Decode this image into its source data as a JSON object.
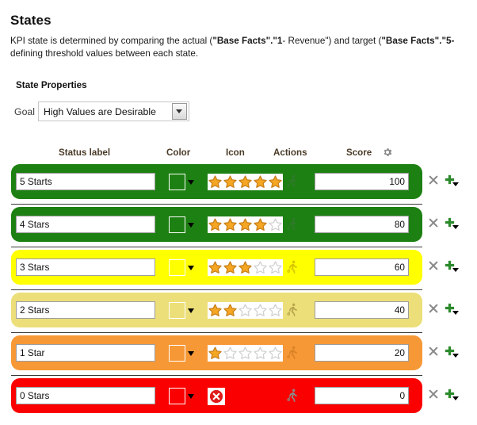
{
  "page": {
    "title": "States",
    "description_line1_a": "KPI state is determined by comparing the actual (",
    "description_bold1": "\"Base Facts\".\"1",
    "description_mid": "- Revenue\") and target (",
    "description_bold2": "\"Base Facts\".\"5-",
    "description_line2": "defining threshold values between each state."
  },
  "state_properties": {
    "section_label": "State Properties",
    "goal_label": "Goal",
    "goal_value": "High Values are Desirable",
    "goal_options": [
      "High Values are Desirable"
    ]
  },
  "table": {
    "headers": {
      "status_label": "Status label",
      "color": "Color",
      "icon": "Icon",
      "actions": "Actions",
      "score": "Score",
      "score_settings_icon": "gear-icon"
    },
    "rows": [
      {
        "label": "5 Starts",
        "score": "100",
        "row_color": "#1d8012",
        "swatch_color": "#1d8012",
        "swatch_border": "light",
        "icon_type": "stars",
        "stars_filled": 5,
        "stars_total": 5,
        "action_icon": "runner-icon",
        "action_icon_color": "#2f7a2a",
        "delete_icon": "close-icon",
        "add_icon": "plus-icon"
      },
      {
        "label": "4 Stars",
        "score": "80",
        "row_color": "#1d8012",
        "swatch_color": "#1d8012",
        "swatch_border": "light",
        "icon_type": "stars",
        "stars_filled": 4,
        "stars_total": 5,
        "action_icon": "runner-icon",
        "action_icon_color": "#2f7a2a",
        "delete_icon": "close-icon",
        "add_icon": "plus-icon"
      },
      {
        "label": "3 Stars",
        "score": "60",
        "row_color": "#ffff00",
        "swatch_color": "#ffff00",
        "swatch_border": "light",
        "icon_type": "stars",
        "stars_filled": 3,
        "stars_total": 5,
        "action_icon": "runner-icon",
        "action_icon_color": "#d6c400",
        "delete_icon": "close-icon",
        "add_icon": "plus-icon"
      },
      {
        "label": "2 Stars",
        "score": "40",
        "row_color": "#ecdf79",
        "swatch_color": "#ecdf79",
        "swatch_border": "light",
        "icon_type": "stars",
        "stars_filled": 2,
        "stars_total": 5,
        "action_icon": "runner-icon",
        "action_icon_color": "#b9a74f",
        "delete_icon": "close-icon",
        "add_icon": "plus-icon"
      },
      {
        "label": "1 Star",
        "score": "20",
        "row_color": "#f79837",
        "swatch_color": "#f79837",
        "swatch_border": "light",
        "icon_type": "stars",
        "stars_filled": 1,
        "stars_total": 5,
        "action_icon": "runner-icon",
        "action_icon_color": "#d98226",
        "delete_icon": "close-icon",
        "add_icon": "plus-icon"
      },
      {
        "label": "0 Stars",
        "score": "0",
        "row_color": "#fa0000",
        "swatch_color": "#fa0000",
        "swatch_border": "light",
        "icon_type": "error-circle",
        "stars_filled": 0,
        "stars_total": 0,
        "action_icon": "runner-icon",
        "action_icon_color": "#8a8a8a",
        "delete_icon": "close-icon",
        "add_icon": "plus-icon"
      }
    ]
  },
  "colors": {
    "star_filled": "#f5a623",
    "star_empty": "#d0d0d0",
    "delete_icon": "#8a8a8a",
    "add_icon": "#2c8a2c",
    "header_text": "#4a3b28"
  }
}
